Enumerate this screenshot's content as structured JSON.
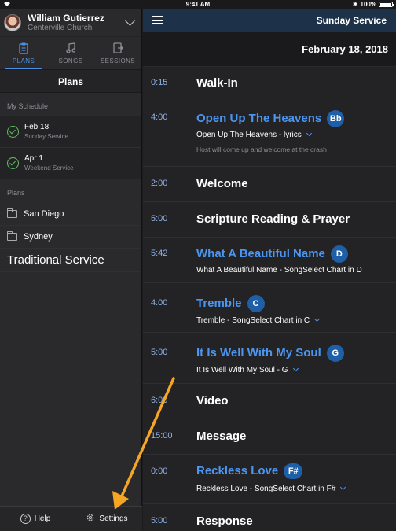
{
  "statusbar": {
    "time": "9:41 AM",
    "battery": "100%"
  },
  "user": {
    "name": "William Gutierrez",
    "org": "Centerville Church"
  },
  "tabs": [
    {
      "label": "PLANS",
      "icon": "clipboard-icon"
    },
    {
      "label": "SONGS",
      "icon": "music-note-icon"
    },
    {
      "label": "SESSIONS",
      "icon": "session-icon"
    }
  ],
  "sidebar": {
    "title": "Plans",
    "schedule_label": "My Schedule",
    "schedule": [
      {
        "date": "Feb 18",
        "service": "Sunday Service"
      },
      {
        "date": "Apr 1",
        "service": "Weekend Service"
      }
    ],
    "plans_label": "Plans",
    "folders": [
      {
        "name": "San Diego"
      },
      {
        "name": "Sydney"
      }
    ],
    "traditional": "Traditional Service",
    "help": "Help",
    "settings": "Settings"
  },
  "header": {
    "title": "Sunday Service",
    "date": "February 18, 2018"
  },
  "items": [
    {
      "length": "0:15",
      "title": "Walk-In"
    },
    {
      "length": "4:00",
      "title": "Open Up The Heavens",
      "key": "Bb",
      "sub": "Open Up The Heavens - lyrics",
      "note": "Host will come up and welcome at the crash"
    },
    {
      "length": "2:00",
      "title": "Welcome"
    },
    {
      "length": "5:00",
      "title": "Scripture Reading & Prayer"
    },
    {
      "length": "5:42",
      "title": "What A Beautiful Name",
      "key": "D",
      "sub": "What A Beautiful Name - SongSelect Chart in D"
    },
    {
      "length": "4:00",
      "title": "Tremble",
      "key": "C",
      "sub": "Tremble - SongSelect Chart in C"
    },
    {
      "length": "5:00",
      "title": "It Is Well With My Soul",
      "key": "G",
      "sub": "It Is Well With My Soul - G"
    },
    {
      "length": "6:00",
      "title": "Video"
    },
    {
      "length": "15:00",
      "title": "Message"
    },
    {
      "length": "0:00",
      "title": "Reckless Love",
      "key": "F#",
      "sub": "Reckless Love - SongSelect Chart in F#"
    },
    {
      "length": "5:00",
      "title": "Response"
    }
  ],
  "colors": {
    "accent": "#4b96f0",
    "navbar": "#1d3148",
    "key_badge": "#1e5fa8",
    "annotation_arrow": "#f5a623",
    "check": "#5fc15f"
  }
}
